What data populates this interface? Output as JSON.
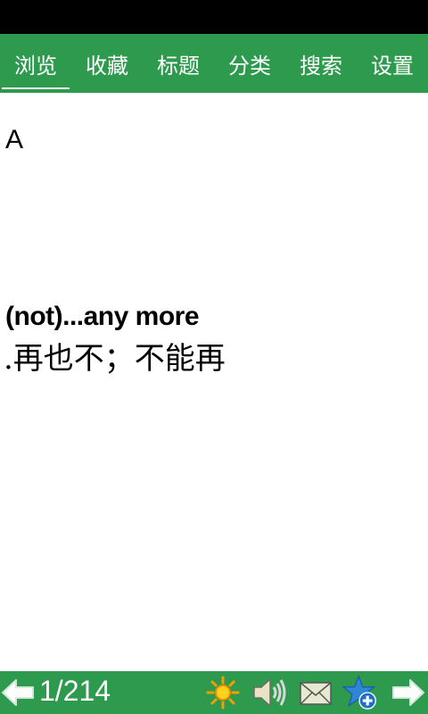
{
  "tabs": [
    {
      "label": "浏览",
      "active": true
    },
    {
      "label": "收藏",
      "active": false
    },
    {
      "label": "标题",
      "active": false
    },
    {
      "label": "分类",
      "active": false
    },
    {
      "label": "搜索",
      "active": false
    },
    {
      "label": "设置",
      "active": false
    }
  ],
  "entry": {
    "letter": "A",
    "phrase": "(not)...any more",
    "meaning": ".再也不；不能再"
  },
  "footer": {
    "page_counter": "1/214",
    "icons": [
      "prev-arrow-icon",
      "sun-icon",
      "speaker-icon",
      "mail-icon",
      "favorite-add-icon",
      "next-arrow-icon"
    ]
  },
  "colors": {
    "accent": "#2e9a4e",
    "status_bar": "#000000"
  }
}
